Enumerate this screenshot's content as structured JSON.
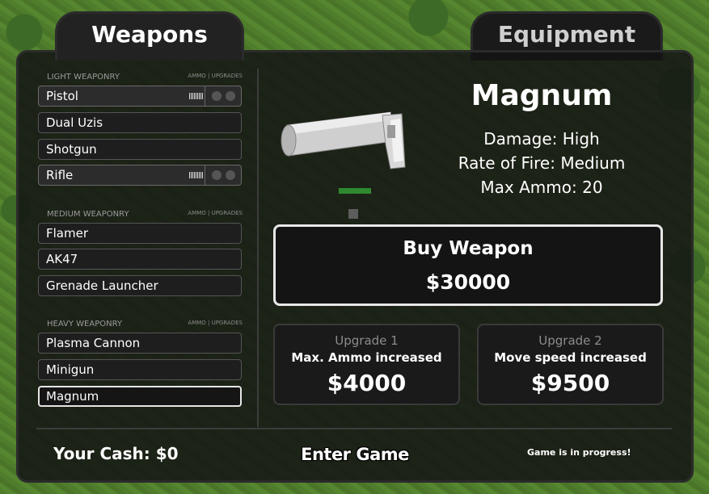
{
  "tabs": [
    {
      "label": "Weapons",
      "active": true
    },
    {
      "label": "Equipment",
      "active": false
    }
  ],
  "categories": [
    {
      "title": "LIGHT WEAPONRY",
      "sub": "AMMO | UPGRADES",
      "items": [
        "Pistol",
        "Dual Uzis",
        "Shotgun",
        "Rifle"
      ]
    },
    {
      "title": "MEDIUM WEAPONRY",
      "sub": "AMMO | UPGRADES",
      "items": [
        "Flamer",
        "AK47",
        "Grenade Launcher"
      ]
    },
    {
      "title": "HEAVY WEAPONRY",
      "sub": "AMMO | UPGRADES",
      "items": [
        "Plasma Cannon",
        "Minigun",
        "Magnum"
      ]
    }
  ],
  "selected_weapon": {
    "name": "Magnum",
    "damage": "Damage: High",
    "rate_of_fire": "Rate of Fire: Medium",
    "max_ammo": "Max Ammo: 20"
  },
  "buy": {
    "label": "Buy Weapon",
    "price": "$30000"
  },
  "upgrades": [
    {
      "title": "Upgrade 1",
      "desc": "Max. Ammo increased",
      "price": "$4000"
    },
    {
      "title": "Upgrade 2",
      "desc": "Move speed increased",
      "price": "$9500"
    }
  ],
  "footer": {
    "cash": "Your Cash: $0",
    "enter_game": "Enter Game",
    "status": "Game is in progress!"
  },
  "icons": {
    "gun_preview": "magnum-gun-icon",
    "upgrade_slot": "upgrade-slot-icon",
    "ammo": "ammo-icon"
  },
  "colors": {
    "panel": "#141414",
    "accent": "#2f8a2f",
    "grass": "#4f7d2c"
  }
}
